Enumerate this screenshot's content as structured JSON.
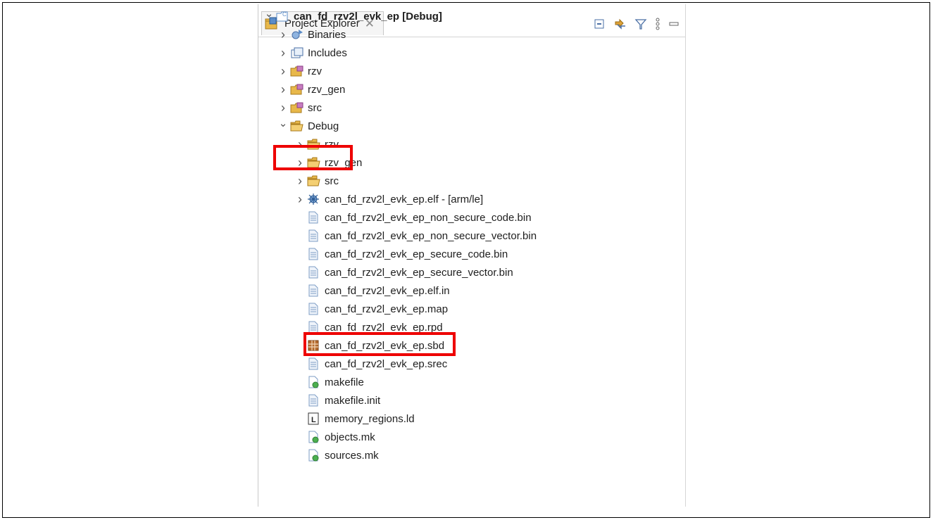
{
  "panel": {
    "tab_label": "Project Explorer",
    "tab_close": "✕",
    "toolbar_icons": [
      "collapse-all-icon",
      "link-with-editor-icon",
      "filter-icon",
      "view-menu-icon",
      "minimize-icon"
    ]
  },
  "tree": {
    "project": {
      "label": "can_fd_rzv2l_evk_ep [Debug]",
      "expanded": true
    },
    "top_items": [
      {
        "label": "Binaries",
        "icon": "binaries-icon"
      },
      {
        "label": "Includes",
        "icon": "includes-icon"
      },
      {
        "label": "rzv",
        "icon": "source-folder-icon"
      },
      {
        "label": "rzv_gen",
        "icon": "source-folder-icon"
      },
      {
        "label": "src",
        "icon": "source-folder-icon"
      }
    ],
    "debug_folder": {
      "label": "Debug",
      "icon": "folder-icon",
      "expanded": true
    },
    "debug_children": [
      {
        "label": "rzv",
        "icon": "folder-icon",
        "expandable": true
      },
      {
        "label": "rzv_gen",
        "icon": "folder-icon",
        "expandable": true
      },
      {
        "label": "src",
        "icon": "folder-icon",
        "expandable": true
      },
      {
        "label": "can_fd_rzv2l_evk_ep.elf - [arm/le]",
        "icon": "elf-binary-icon",
        "expandable": true
      },
      {
        "label": "can_fd_rzv2l_evk_ep_non_secure_code.bin",
        "icon": "file-icon"
      },
      {
        "label": "can_fd_rzv2l_evk_ep_non_secure_vector.bin",
        "icon": "file-icon"
      },
      {
        "label": "can_fd_rzv2l_evk_ep_secure_code.bin",
        "icon": "file-icon"
      },
      {
        "label": "can_fd_rzv2l_evk_ep_secure_vector.bin",
        "icon": "file-icon"
      },
      {
        "label": "can_fd_rzv2l_evk_ep.elf.in",
        "icon": "file-icon"
      },
      {
        "label": "can_fd_rzv2l_evk_ep.map",
        "icon": "file-icon"
      },
      {
        "label": "can_fd_rzv2l_evk_ep.rpd",
        "icon": "file-icon"
      },
      {
        "label": "can_fd_rzv2l_evk_ep.sbd",
        "icon": "grid-file-icon"
      },
      {
        "label": "can_fd_rzv2l_evk_ep.srec",
        "icon": "file-icon"
      },
      {
        "label": "makefile",
        "icon": "makefile-icon"
      },
      {
        "label": "makefile.init",
        "icon": "file-icon"
      },
      {
        "label": "memory_regions.ld",
        "icon": "linker-script-icon"
      },
      {
        "label": "objects.mk",
        "icon": "makefile-icon"
      },
      {
        "label": "sources.mk",
        "icon": "makefile-icon"
      }
    ]
  },
  "colors": {
    "highlight": "#ee0000",
    "folder": "#e8b84a",
    "file": "#7d9cc4"
  }
}
